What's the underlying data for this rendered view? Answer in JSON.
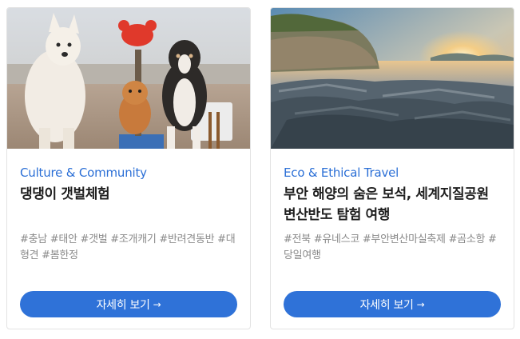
{
  "cards": [
    {
      "category": "Culture & Community",
      "title": "댕댕이 갯벌체험",
      "tags": [
        "#충남",
        "#태안",
        "#갯벌",
        "#조개캐기",
        "#반려견동반",
        "#대형견",
        "#봄한정"
      ],
      "button_label": "자세히 보기",
      "button_arrow": "→",
      "image": "dogs-on-tidal-flat-photo"
    },
    {
      "category": "Eco & Ethical Travel",
      "title": "부안 해양의 숨은 보석, 세계지질공원 변산반도 탐험 여행",
      "tags": [
        "#전북",
        "#유네스코",
        "#부안변산마실축제",
        "#곰소항",
        "#당일여행"
      ],
      "button_label": "자세히 보기",
      "button_arrow": "→",
      "image": "rocky-coast-sunset-photo"
    }
  ],
  "colors": {
    "accent": "#2b6fd6",
    "button": "#2f72d8",
    "tag": "#8a8a8a",
    "title": "#1f1f1f"
  }
}
